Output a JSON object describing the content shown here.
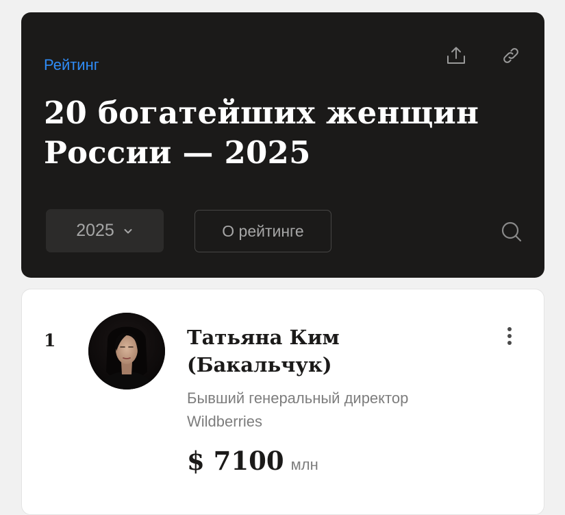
{
  "header": {
    "breadcrumb": "Рейтинг",
    "title": "20 богатейших женщин России — 2025",
    "share_icon": "share-icon",
    "link_icon": "link-icon",
    "year_select": {
      "value": "2025",
      "icon": "chevron-down-icon"
    },
    "about_button": "О рейтинге",
    "search_icon": "search-icon"
  },
  "list": {
    "items": [
      {
        "rank": "1",
        "name": "Татьяна Ким (Бакальчук)",
        "description": "Бывший генеральный директор Wildberries",
        "wealth_value": "$ 7100",
        "wealth_unit": "млн",
        "menu_icon": "more-vertical-icon"
      }
    ]
  },
  "colors": {
    "background": "#f1f1f1",
    "header_bg": "#1b1a19",
    "accent": "#2f8cf7",
    "muted_text": "#7d7d7d"
  }
}
